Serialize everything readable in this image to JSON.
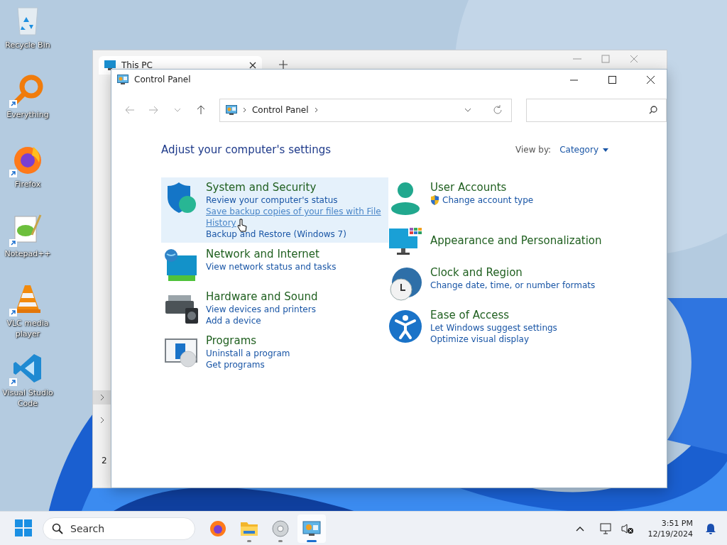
{
  "desktop_icons": [
    {
      "label": "Recycle Bin",
      "kind": "recycle",
      "shortcut": false
    },
    {
      "label": "Everything",
      "kind": "everything",
      "shortcut": true
    },
    {
      "label": "Firefox",
      "kind": "firefox",
      "shortcut": true
    },
    {
      "label": "Notepad++",
      "kind": "notepad",
      "shortcut": true
    },
    {
      "label": "VLC media player",
      "kind": "vlc",
      "shortcut": true
    },
    {
      "label": "Visual Studio Code",
      "kind": "vscode",
      "shortcut": true
    }
  ],
  "back_window": {
    "tab": "This PC",
    "status": "2"
  },
  "window": {
    "title": "Control Panel"
  },
  "address": {
    "crumbs": [
      "Control Panel"
    ]
  },
  "heading": "Adjust your computer's settings",
  "view_by": {
    "label": "View by:",
    "value": "Category"
  },
  "columns": [
    {
      "categories": [
        {
          "kind": "system",
          "title": "System and Security",
          "selected": true,
          "links": [
            {
              "text": "Review your computer's status",
              "hovered": false,
              "shield": false
            },
            {
              "text": "Save backup copies of your files with File History",
              "hovered": true,
              "shield": false
            },
            {
              "text": "Backup and Restore (Windows 7)",
              "hovered": false,
              "shield": false
            }
          ]
        },
        {
          "kind": "network",
          "title": "Network and Internet",
          "selected": false,
          "links": [
            {
              "text": "View network status and tasks",
              "hovered": false,
              "shield": false
            }
          ]
        },
        {
          "kind": "hardware",
          "title": "Hardware and Sound",
          "selected": false,
          "links": [
            {
              "text": "View devices and printers",
              "hovered": false,
              "shield": false
            },
            {
              "text": "Add a device",
              "hovered": false,
              "shield": false
            }
          ]
        },
        {
          "kind": "programs",
          "title": "Programs",
          "selected": false,
          "links": [
            {
              "text": "Uninstall a program",
              "hovered": false,
              "shield": false
            },
            {
              "text": "Get programs",
              "hovered": false,
              "shield": false
            }
          ]
        }
      ]
    },
    {
      "categories": [
        {
          "kind": "users",
          "title": "User Accounts",
          "selected": false,
          "links": [
            {
              "text": "Change account type",
              "hovered": false,
              "shield": true
            }
          ]
        },
        {
          "kind": "appearance",
          "title": "Appearance and Personalization",
          "selected": false
        },
        {
          "kind": "clock",
          "title": "Clock and Region",
          "selected": false,
          "links": [
            {
              "text": "Change date, time, or number formats",
              "hovered": false,
              "shield": false
            }
          ]
        },
        {
          "kind": "access",
          "title": "Ease of Access",
          "selected": false,
          "links": [
            {
              "text": "Let Windows suggest settings",
              "hovered": false,
              "shield": false
            },
            {
              "text": "Optimize visual display",
              "hovered": false,
              "shield": false
            }
          ]
        }
      ]
    }
  ],
  "taskbar": {
    "search": {
      "placeholder": "Search"
    },
    "apps": [
      {
        "kind": "firefox",
        "running": false,
        "selected": false
      },
      {
        "kind": "explorer",
        "running": true,
        "selected": false
      },
      {
        "kind": "disc",
        "running": true,
        "selected": false
      },
      {
        "kind": "controlpanel",
        "running": true,
        "selected": true
      }
    ],
    "time": "3:51 PM",
    "date": "12/19/2024"
  }
}
